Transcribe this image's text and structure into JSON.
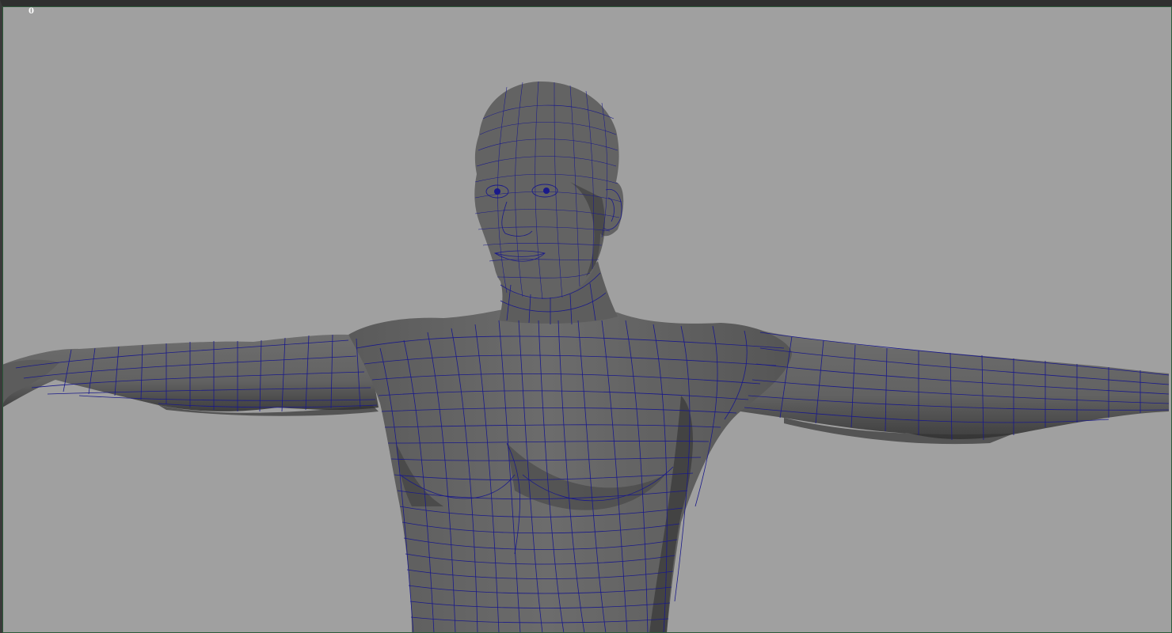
{
  "viewport": {
    "frame_counter": "0"
  },
  "scene": {
    "object": "humanoid-mesh",
    "shading": "smooth-shaded-with-wireframe",
    "colors": {
      "background": "#a0a0a0",
      "mesh_fill": "#646464",
      "mesh_shadow": "#3c3c3c",
      "mesh_highlight": "#7a7a7a",
      "wireframe": "#1a1a8a",
      "frame_counter": "#ffffff"
    }
  }
}
